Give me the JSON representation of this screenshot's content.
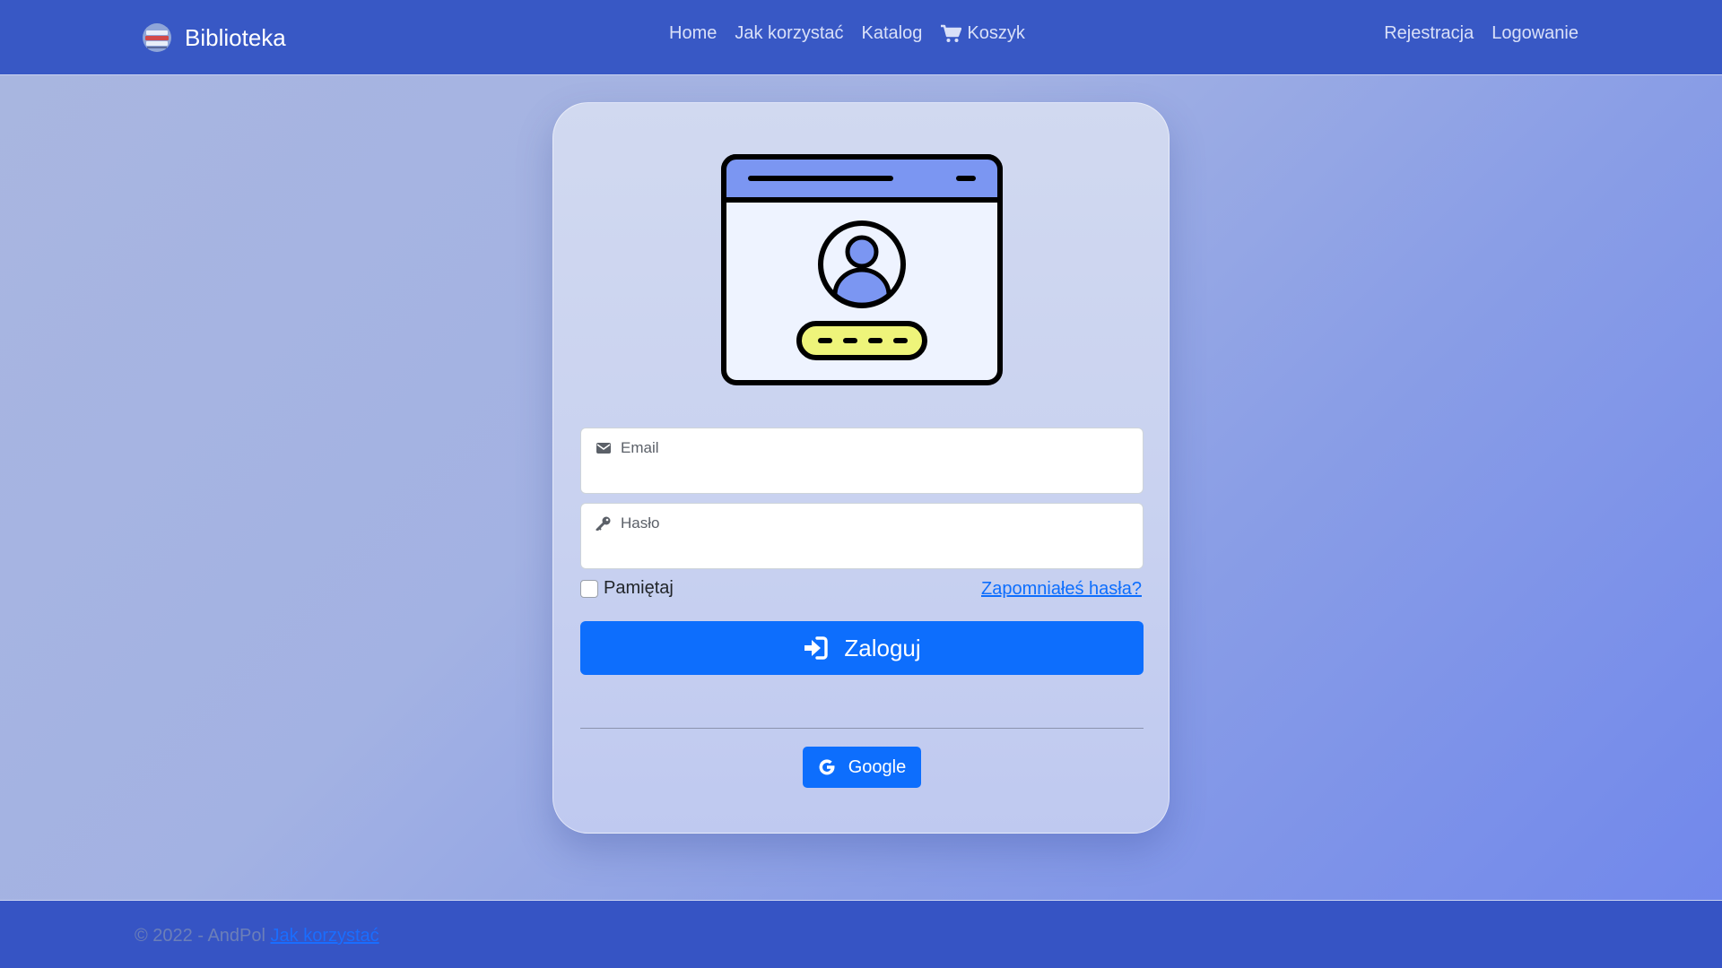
{
  "navbar": {
    "brand": "Biblioteka",
    "links": [
      "Home",
      "Jak korzystać",
      "Katalog"
    ],
    "cart_label": "Koszyk",
    "right_links": [
      "Rejestracja",
      "Logowanie"
    ]
  },
  "login": {
    "email_label": "Email",
    "email_value": "",
    "password_label": "Hasło",
    "password_value": "",
    "remember_label": "Pamiętaj",
    "remember_checked": false,
    "forgot_link": "Zapomniałeś hasła?",
    "submit_label": "Zaloguj",
    "google_label": "Google"
  },
  "footer": {
    "copyright": "© 2022 - AndPol",
    "link": "Jak korzystać"
  },
  "colors": {
    "navbar": "#3858c5",
    "primary": "#0d6efd",
    "card": "#d1d9f0"
  }
}
